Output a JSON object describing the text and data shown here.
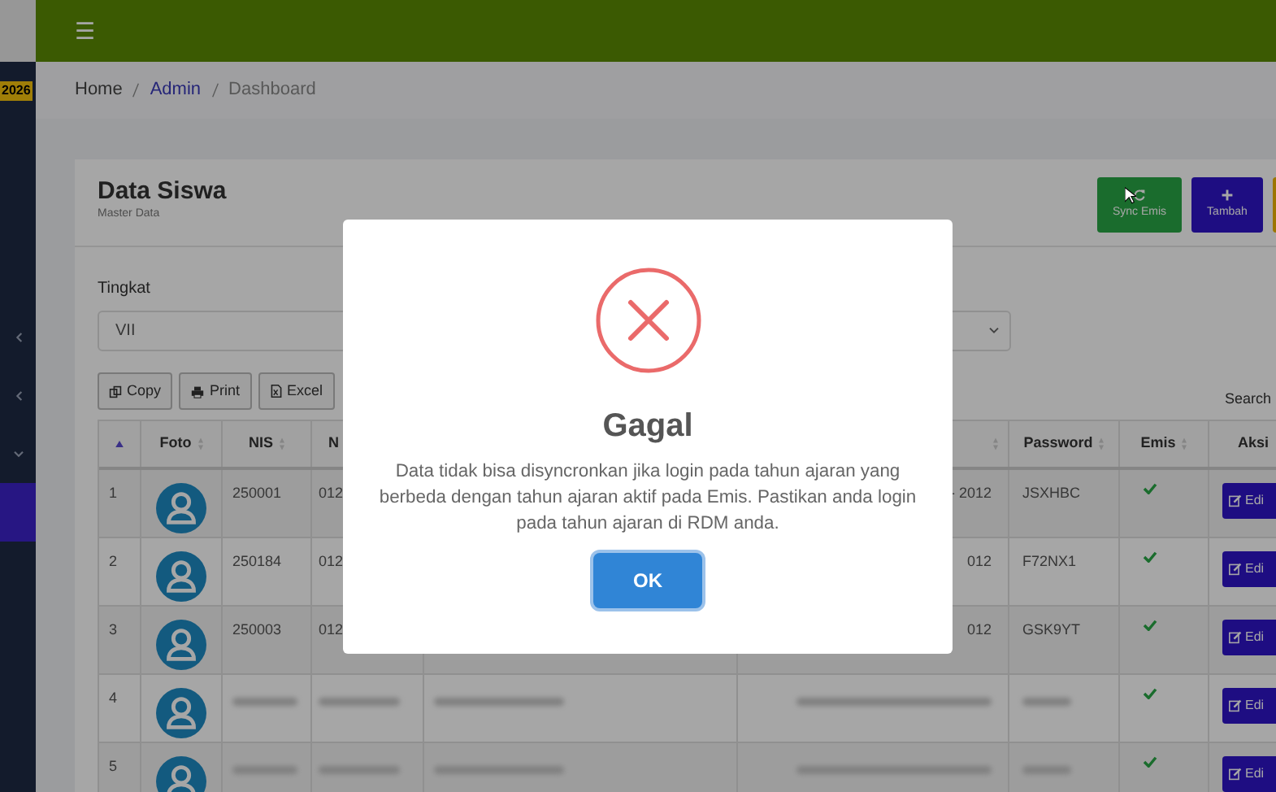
{
  "sidebar": {
    "year_badge": "2026",
    "items": [
      {
        "kind": "chevron-left",
        "selected": false
      },
      {
        "kind": "chevron-left",
        "selected": false
      },
      {
        "kind": "chevron-down",
        "selected": false
      },
      {
        "kind": "blank",
        "selected": true
      }
    ]
  },
  "header": {
    "menu_icon": "☰"
  },
  "breadcrumb": [
    {
      "label": "Home",
      "link": false
    },
    {
      "label": "Admin",
      "link": true
    },
    {
      "label": "Dashboard",
      "link": false
    }
  ],
  "card": {
    "title": "Data Siswa",
    "subtitle": "Master Data",
    "actions": [
      {
        "label": "Sync Emis",
        "kind": "sync"
      },
      {
        "label": "Tambah",
        "kind": "add"
      },
      {
        "kind": "more"
      }
    ]
  },
  "filter": {
    "label": "Tingkat",
    "value": "VII"
  },
  "export_buttons": [
    {
      "label": "Copy",
      "kind": "copy"
    },
    {
      "label": "Print",
      "kind": "print"
    },
    {
      "label": "Excel",
      "kind": "excel"
    }
  ],
  "search_label": "Search",
  "table": {
    "columns": [
      "",
      "Foto",
      "NIS",
      "N",
      "",
      "",
      "Password",
      "Emis",
      "Aksi"
    ],
    "rows": [
      {
        "no": "1",
        "nis": "250001",
        "col4": "012",
        "col6": "- 2012",
        "password": "JSXHBC",
        "emis": true,
        "action": "Edi",
        "blurred": false
      },
      {
        "no": "2",
        "nis": "250184",
        "col4": "012",
        "col6": "012",
        "password": "F72NX1",
        "emis": true,
        "action": "Edi",
        "blurred": false
      },
      {
        "no": "3",
        "nis": "250003",
        "col4": "012",
        "col6": "012",
        "password": "GSK9YT",
        "emis": true,
        "action": "Edi",
        "blurred": false
      },
      {
        "no": "4",
        "emis": true,
        "action": "Edi",
        "blurred": true
      },
      {
        "no": "5",
        "emis": true,
        "action": "Edi",
        "blurred": true
      }
    ]
  },
  "dialog": {
    "kind": "error",
    "title": "Gagal",
    "message": "Data tidak bisa disyncronkan jika login pada tahun ajaran yang berbeda dengan tahun ajaran aktif pada Emis. Pastikan anda login pada tahun ajaran di RDM anda.",
    "button": "OK"
  }
}
